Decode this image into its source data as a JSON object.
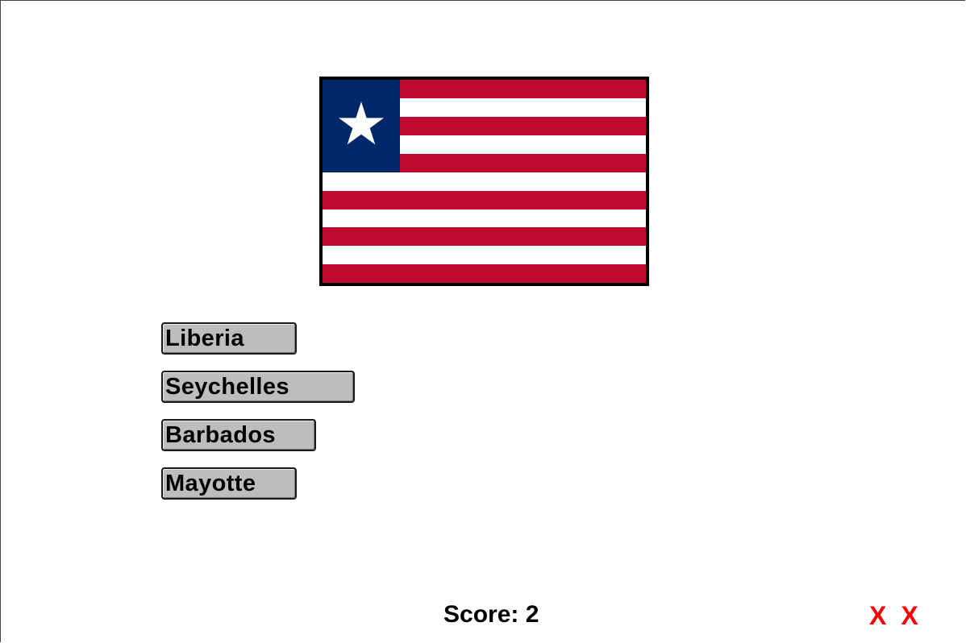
{
  "flag": {
    "icon": "liberia-flag-icon",
    "colors": {
      "red": "#bf0a30",
      "white": "#ffffff",
      "blue": "#002868",
      "border": "#000000"
    }
  },
  "answers": [
    {
      "label": "Liberia"
    },
    {
      "label": "Seychelles"
    },
    {
      "label": "Barbados"
    },
    {
      "label": "Mayotte"
    }
  ],
  "score": {
    "text": "Score: 2"
  },
  "strikes": {
    "marks": [
      "X",
      "X"
    ],
    "color": "#ff0000"
  }
}
